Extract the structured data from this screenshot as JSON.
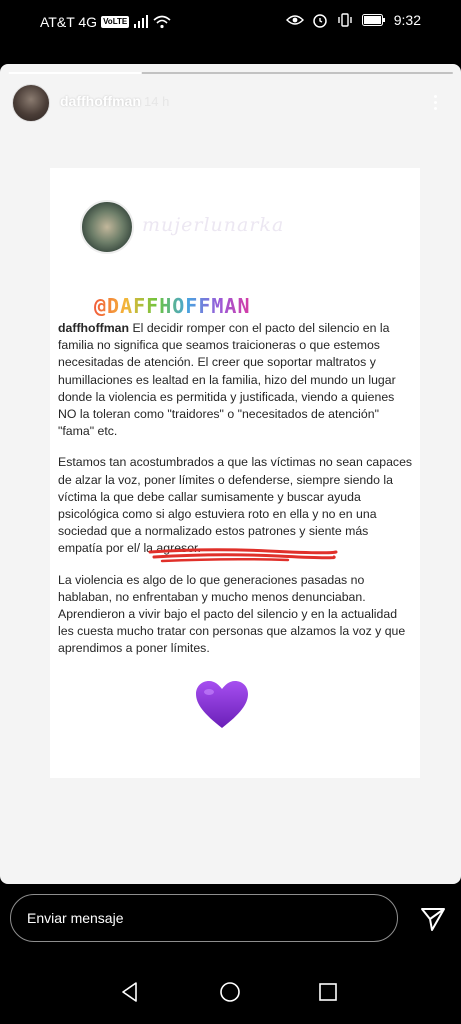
{
  "status_bar": {
    "carrier": "AT&T 4G",
    "volte": "VoLTE",
    "time": "9:32"
  },
  "story": {
    "username": "daffhoffman",
    "time_ago": "14 h",
    "progress_fraction": 0.3,
    "post": {
      "handle": "mujerlunarka",
      "mention": "@DAFFHOFFMAN",
      "caption_author": "daffhoffman",
      "paragraph1": " El decidir romper con el pacto del silencio en la familia no significa que seamos traicioneras o que estemos necesitadas de atención. El creer que soportar maltratos y humillaciones es lealtad en la familia, hizo del mundo un lugar donde la violencia es permitida y justificada, viendo a quienes NO la toleran como \"traidores\" o \"necesitados de atención\" \"fama\" etc.",
      "paragraph2": "Estamos tan acostumbrados a que las víctimas no sean capaces de alzar la voz, poner límites o defenderse, siempre siendo la víctima la que debe callar sumisamente y buscar ayuda psicológica como si algo estuviera roto en ella y no en una sociedad que a normalizado estos patrones y siente más empatía por el/ la agresor.",
      "paragraph3": "La violencia es algo de lo que generaciones pasadas no hablaban, no enfrentaban y mucho menos denunciaban. Aprendieron a vivir bajo el pacto del silencio y en la actualidad les cuesta mucho tratar con personas que alzamos la voz y que aprendimos a poner límites."
    }
  },
  "reply": {
    "placeholder": "Enviar mensaje"
  },
  "icons": {
    "heart": "purple-heart-icon",
    "send": "send-icon",
    "back": "back-icon",
    "home": "home-icon",
    "recents": "recents-icon"
  },
  "colors": {
    "heart": "#8a2be2",
    "underline": "#e0302a"
  }
}
